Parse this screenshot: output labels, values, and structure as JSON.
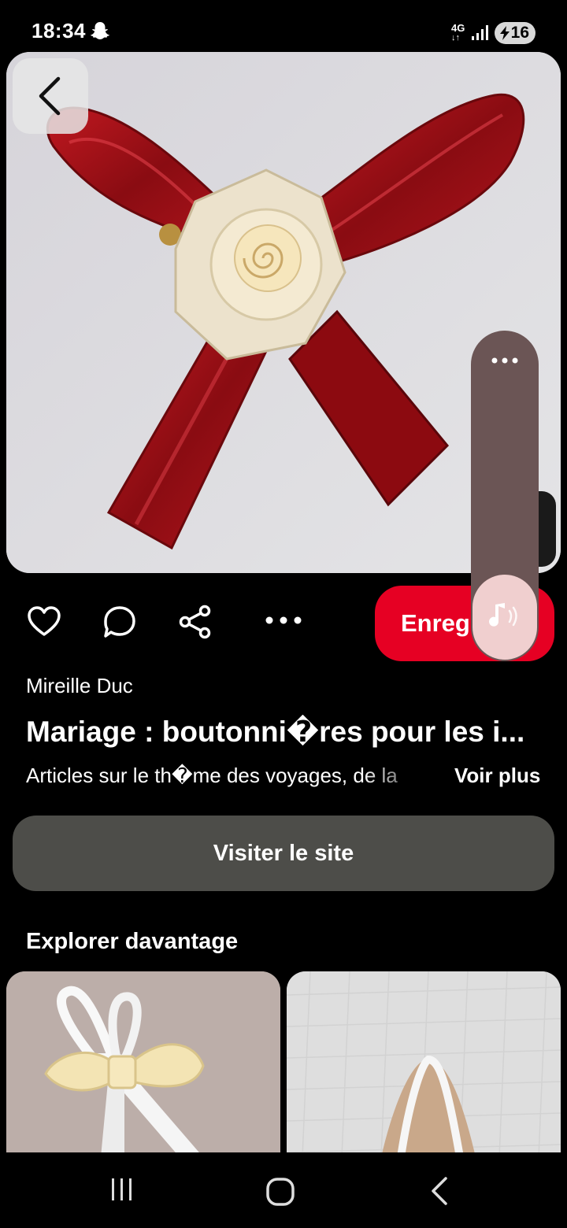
{
  "status_bar": {
    "time": "18:34",
    "network": "4G",
    "battery": "16"
  },
  "pin": {
    "author": "Mireille Duc",
    "title": "Mariage : boutonni�res pour les i...",
    "description": "Articles sur le th�me des voyages, de la",
    "see_more_label": "Voir plus"
  },
  "actions": {
    "save_label": "Enregi"
  },
  "visit_label": "Visiter le site",
  "explore_heading": "Explorer davantage",
  "colors": {
    "accent": "#e60023",
    "visit_bg": "#4d4d49",
    "background": "#000000"
  },
  "icons": [
    "back-icon",
    "heart-icon",
    "comment-icon",
    "share-icon",
    "more-icon",
    "volume-icon",
    "recent-apps-icon",
    "home-icon",
    "nav-back-icon"
  ]
}
